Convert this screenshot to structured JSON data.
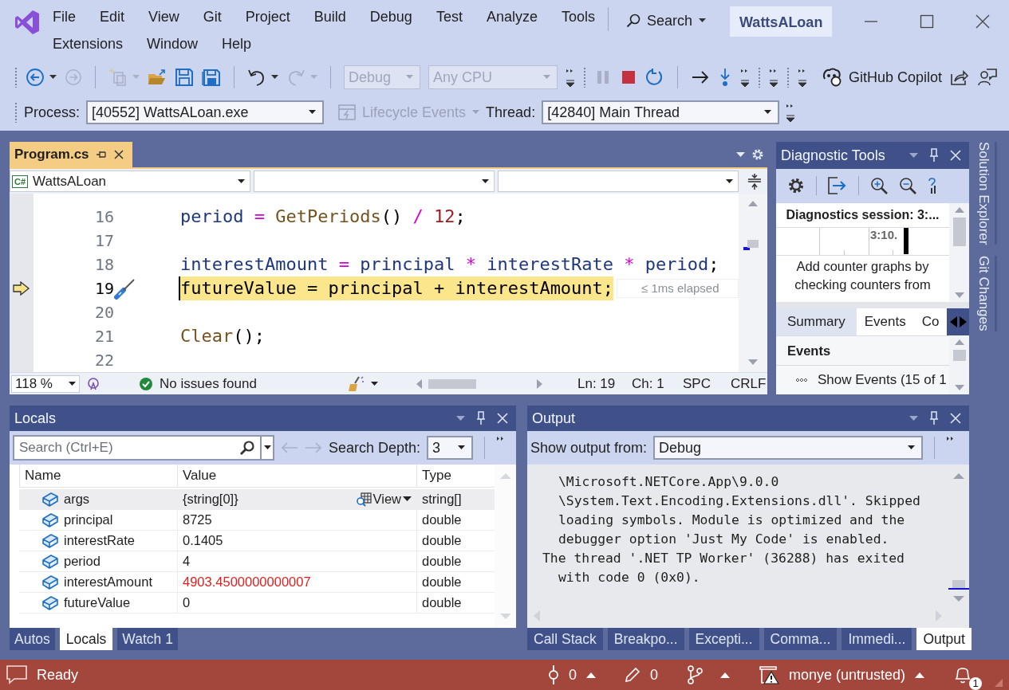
{
  "menu_items": [
    "File",
    "Edit",
    "View",
    "Git",
    "Project",
    "Build",
    "Debug",
    "Test",
    "Analyze",
    "Tools",
    "Extensions",
    "Window",
    "Help"
  ],
  "search_label": "Search",
  "window_title": "WattsALoan",
  "toolbar": {
    "configuration": {
      "value": "Debug",
      "disabled": true
    },
    "platform": {
      "value": "Any CPU",
      "disabled": true
    },
    "copilot": "GitHub Copilot"
  },
  "debug_location": {
    "process_label": "Process:",
    "process": "[40552] WattsALoan.exe",
    "lifecycle": {
      "label": "Lifecycle Events",
      "disabled": true
    },
    "thread_label": "Thread:",
    "thread": "[42840] Main Thread"
  },
  "editor": {
    "tab": {
      "label": "Program.cs",
      "selected": true
    },
    "project_badge": "C#",
    "project": "WattsALoan",
    "lines": [
      {
        "number": "16",
        "current": false,
        "tokens": [
          {
            "var": "period"
          },
          {
            "op": " = "
          },
          {
            "method": "GetPeriods"
          },
          {
            "punct": "() "
          },
          {
            "op": "/ "
          },
          {
            "num": "12"
          },
          {
            "punct": ";"
          }
        ]
      },
      {
        "number": "17",
        "current": false
      },
      {
        "number": "18",
        "current": false,
        "tokens": [
          {
            "var": "interestAmount"
          },
          {
            "op": " = "
          },
          {
            "var": "principal"
          },
          {
            "op": " * "
          },
          {
            "var": "interestRate"
          },
          {
            "op": " * "
          },
          {
            "var": "period"
          },
          {
            "punct": ";"
          }
        ]
      },
      {
        "number": "19",
        "current": true,
        "tokens": [
          {
            "var": "futureValue"
          },
          {
            "op": " = "
          },
          {
            "var": "principal"
          },
          {
            "op": " + "
          },
          {
            "var": "interestAmount"
          },
          {
            "punct": ";"
          }
        ]
      },
      {
        "number": "20",
        "current": false
      },
      {
        "number": "21",
        "current": false,
        "tokens": [
          {
            "method": "Clear"
          },
          {
            "punct": "();"
          }
        ]
      },
      {
        "number": "22",
        "current": false
      }
    ],
    "elapsed": "≤ 1ms elapsed",
    "zoom": "118 %",
    "issues": "No issues found",
    "line": "Ln: 19",
    "column": "Ch: 1",
    "whitespace": "SPC",
    "line_endings": "CRLF"
  },
  "diagnostics": {
    "title": "Diagnostic Tools",
    "session": "Diagnostics session: 3:...",
    "timeline_label": "3:10.",
    "hint": "Add counter graphs by checking counters from",
    "tabs": [
      {
        "label": "Summary",
        "selected": true
      },
      {
        "label": "Events",
        "selected": false
      },
      {
        "label": "Co",
        "selected": false
      }
    ],
    "events_header": "Events",
    "events_row": "Show Events (15 of 1"
  },
  "side_tabs": [
    "Solution Explorer",
    "Git Changes"
  ],
  "locals": {
    "title": "Locals",
    "search": {
      "placeholder": "Search (Ctrl+E)"
    },
    "depth_label": "Search Depth:",
    "depth": "3",
    "columns": [
      "Name",
      "Value",
      "Type"
    ],
    "rows": [
      {
        "name": "args",
        "value": "{string[0]}",
        "type": "string[]",
        "changed": false,
        "selected": true,
        "visualizer": "View"
      },
      {
        "name": "principal",
        "value": "8725",
        "type": "double",
        "changed": false,
        "selected": false
      },
      {
        "name": "interestRate",
        "value": "0.1405",
        "type": "double",
        "changed": false,
        "selected": false
      },
      {
        "name": "period",
        "value": "4",
        "type": "double",
        "changed": false,
        "selected": false
      },
      {
        "name": "interestAmount",
        "value": "4903.4500000000007",
        "type": "double",
        "changed": true,
        "selected": false
      },
      {
        "name": "futureValue",
        "value": "0",
        "type": "double",
        "changed": false,
        "selected": false
      }
    ],
    "tabs": [
      {
        "label": "Autos",
        "selected": false
      },
      {
        "label": "Locals",
        "selected": true
      },
      {
        "label": "Watch 1",
        "selected": false
      }
    ]
  },
  "output": {
    "title": "Output",
    "source_label": "Show output from:",
    "source": "Debug",
    "lines": [
      {
        "text": "\\Microsoft.NETCore.App\\9.0.0",
        "continuation": true
      },
      {
        "text": "\\System.Text.Encoding.Extensions.dll'. Skipped",
        "continuation": true
      },
      {
        "text": "loading symbols. Module is optimized and the",
        "continuation": true
      },
      {
        "text": "debugger option 'Just My Code' is enabled.",
        "continuation": true
      },
      {
        "text": "The thread '.NET TP Worker' (36288) has exited",
        "continuation": false
      },
      {
        "text": "with code 0 (0x0).",
        "continuation": true
      }
    ],
    "tabs": [
      {
        "label": "Call Stack",
        "selected": false
      },
      {
        "label": "Breakpo...",
        "selected": false
      },
      {
        "label": "Excepti...",
        "selected": false
      },
      {
        "label": "Comma...",
        "selected": false
      },
      {
        "label": "Immedi...",
        "selected": false
      },
      {
        "label": "Output",
        "selected": true
      }
    ]
  },
  "status": {
    "message": "Ready",
    "incoming": "0",
    "changes": "0",
    "repo": "monye (untrusted)",
    "notifications": "1"
  }
}
